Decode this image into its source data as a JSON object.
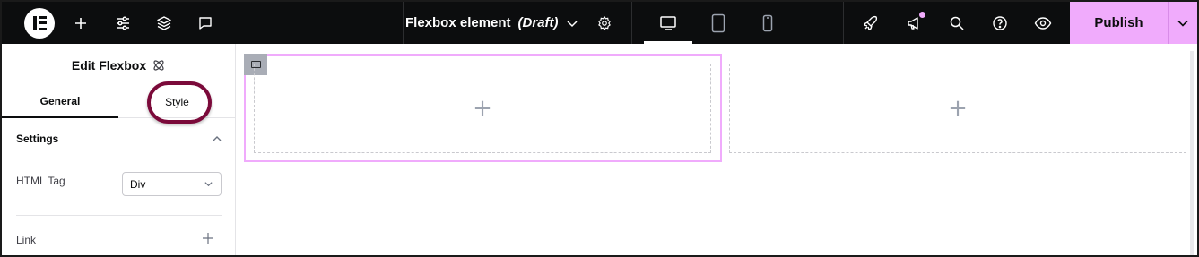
{
  "topbar": {
    "add_icon": "plus-icon",
    "settings_icon": "sliders-icon",
    "layers_icon": "layers-icon",
    "comments_icon": "speech-bubble-icon",
    "document_name": "Flexbox element",
    "document_status": "(Draft)",
    "publish_label": "Publish",
    "colors": {
      "background": "#0c0d0e",
      "accent": "#f0abfc"
    }
  },
  "panel": {
    "title": "Edit Flexbox",
    "tabs": [
      {
        "label": "General",
        "active": true
      },
      {
        "label": "Style",
        "active": false
      }
    ],
    "section": {
      "label": "Settings",
      "expanded": true
    },
    "html_tag": {
      "label": "HTML Tag",
      "value": "Div"
    },
    "link": {
      "label": "Link"
    }
  },
  "canvas": {
    "containers": [
      {
        "selected": true,
        "add_symbol": "+"
      },
      {
        "selected": false,
        "add_symbol": "+"
      }
    ]
  }
}
